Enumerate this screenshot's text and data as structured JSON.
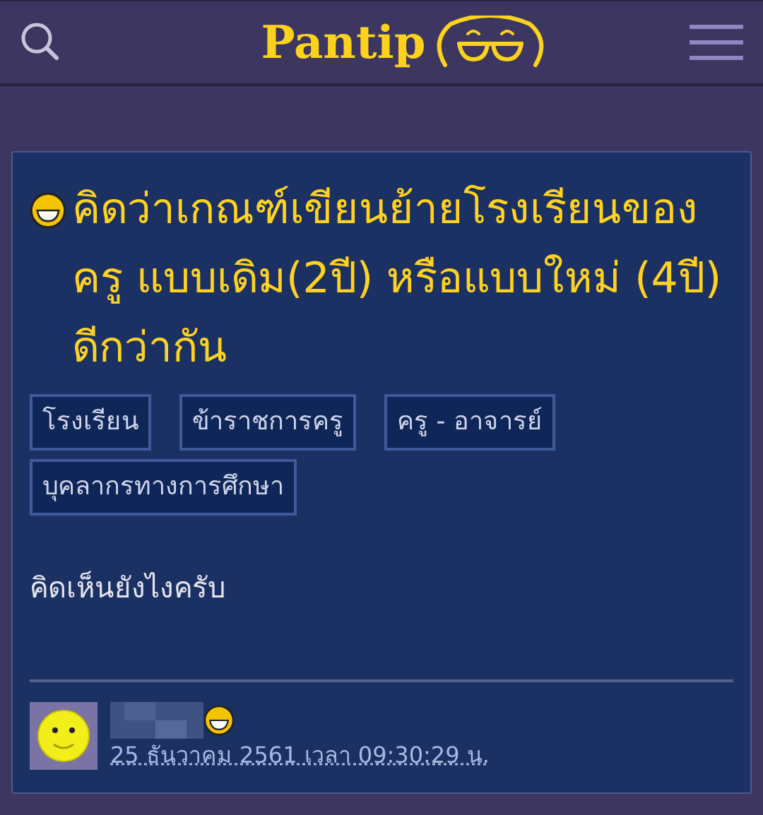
{
  "header": {
    "logo": "Pantip"
  },
  "topic": {
    "title": "คิดว่าเกณฑ์เขียนย้ายโรงเรียนของครู แบบเดิม(2ปี) หรือแบบใหม่ (4ปี) ดีกว่ากัน",
    "tags": [
      "โรงเรียน",
      "ข้าราชการครู",
      "ครู - อาจารย์",
      "บุคลากรทางการศึกษา"
    ],
    "body": "คิดเห็นยังไงครับ",
    "author": {
      "date": "25 ธันวาคม 2561 เวลา 09:30:29 น."
    }
  }
}
